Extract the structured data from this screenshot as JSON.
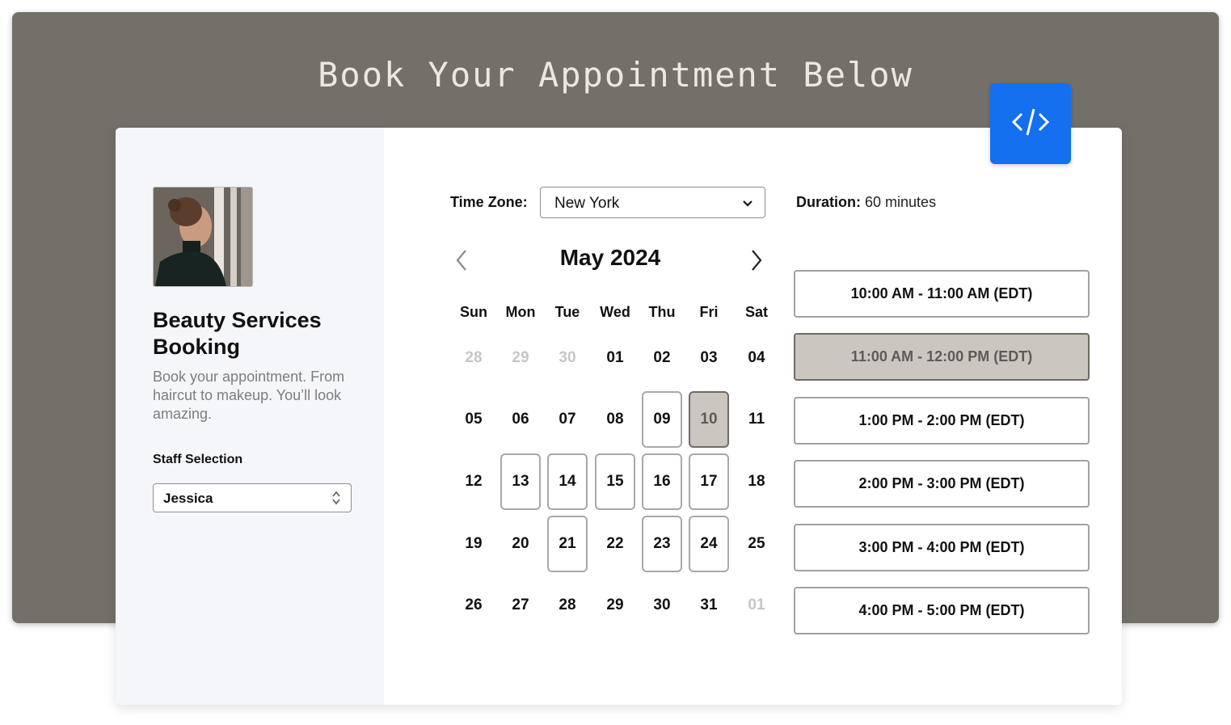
{
  "page": {
    "title": "Book Your Appointment Below",
    "embed_button_icon": "code-icon",
    "accent_color": "#1470ef"
  },
  "sidebar": {
    "brand_title": "Beauty Services Booking",
    "description": "Book your appointment. From haircut to makeup. You’ll look amazing.",
    "staff_label": "Staff Selection",
    "staff_value": "Jessica"
  },
  "booking": {
    "timezone_label": "Time Zone:",
    "timezone_value": "New York",
    "duration_label": "Duration:",
    "duration_value": "60 minutes",
    "month_title": "May 2024",
    "weekdays": [
      "Sun",
      "Mon",
      "Tue",
      "Wed",
      "Thu",
      "Fri",
      "Sat"
    ],
    "days": [
      {
        "label": "28",
        "state": "muted"
      },
      {
        "label": "29",
        "state": "muted"
      },
      {
        "label": "30",
        "state": "muted"
      },
      {
        "label": "01",
        "state": "normal"
      },
      {
        "label": "02",
        "state": "normal"
      },
      {
        "label": "03",
        "state": "normal"
      },
      {
        "label": "04",
        "state": "normal"
      },
      {
        "label": "05",
        "state": "normal"
      },
      {
        "label": "06",
        "state": "normal"
      },
      {
        "label": "07",
        "state": "normal"
      },
      {
        "label": "08",
        "state": "normal"
      },
      {
        "label": "09",
        "state": "available"
      },
      {
        "label": "10",
        "state": "selected"
      },
      {
        "label": "11",
        "state": "normal"
      },
      {
        "label": "12",
        "state": "normal"
      },
      {
        "label": "13",
        "state": "available"
      },
      {
        "label": "14",
        "state": "available"
      },
      {
        "label": "15",
        "state": "available"
      },
      {
        "label": "16",
        "state": "available"
      },
      {
        "label": "17",
        "state": "available"
      },
      {
        "label": "18",
        "state": "normal"
      },
      {
        "label": "19",
        "state": "normal"
      },
      {
        "label": "20",
        "state": "normal"
      },
      {
        "label": "21",
        "state": "available"
      },
      {
        "label": "22",
        "state": "normal"
      },
      {
        "label": "23",
        "state": "available"
      },
      {
        "label": "24",
        "state": "available"
      },
      {
        "label": "25",
        "state": "normal"
      },
      {
        "label": "26",
        "state": "normal"
      },
      {
        "label": "27",
        "state": "normal"
      },
      {
        "label": "28",
        "state": "normal"
      },
      {
        "label": "29",
        "state": "normal"
      },
      {
        "label": "30",
        "state": "normal"
      },
      {
        "label": "31",
        "state": "normal"
      },
      {
        "label": "01",
        "state": "muted"
      }
    ],
    "time_slots": [
      {
        "label": "10:00 AM - 11:00 AM (EDT)",
        "selected": false
      },
      {
        "label": "11:00 AM - 12:00 PM (EDT)",
        "selected": true
      },
      {
        "label": "1:00 PM - 2:00 PM (EDT)",
        "selected": false
      },
      {
        "label": "2:00 PM - 3:00 PM (EDT)",
        "selected": false
      },
      {
        "label": "3:00 PM - 4:00 PM (EDT)",
        "selected": false
      },
      {
        "label": "4:00 PM - 5:00 PM (EDT)",
        "selected": false
      }
    ]
  }
}
